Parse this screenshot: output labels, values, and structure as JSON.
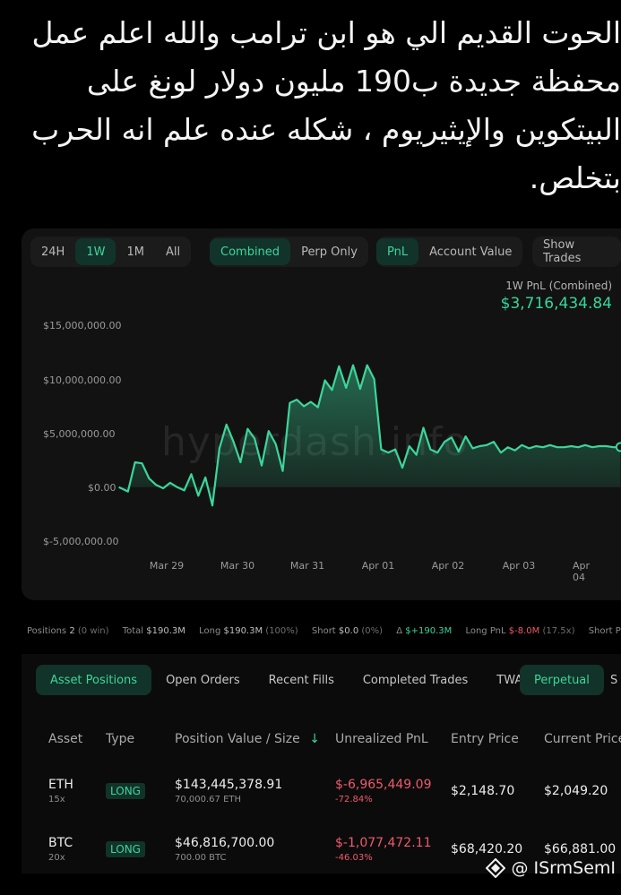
{
  "caption": "الحوت القديم الي هو ابن ترامب والله اعلم عمل\nمحفظة جديدة ب190 مليون دولار لونغ على\nالبيتكوين والإيثيريوم ، شكله عنده علم انه الحرب\nبتخلص.",
  "time_filters": [
    {
      "label": "24H",
      "active": false
    },
    {
      "label": "1W",
      "active": true
    },
    {
      "label": "1M",
      "active": false
    },
    {
      "label": "All",
      "active": false
    }
  ],
  "scope_filters": [
    {
      "label": "Combined",
      "active": true
    },
    {
      "label": "Perp Only",
      "active": false
    }
  ],
  "metric_filters": [
    {
      "label": "PnL",
      "active": true
    },
    {
      "label": "Account Value",
      "active": false
    }
  ],
  "show_trades_label": "Show Trades",
  "pnl_title": "1W PnL (Combined)",
  "pnl_value": "$3,716,434.84",
  "watermark": "hyperdash.info",
  "chart_data": {
    "type": "area",
    "y_ticks": [
      "$15,000,000.00",
      "$10,000,000.00",
      "$5,000,000.00",
      "$0.00",
      "$-5,000,000.00"
    ],
    "x_ticks": [
      "Mar 29",
      "Mar 30",
      "Mar 31",
      "Apr 01",
      "Apr 02",
      "Apr 03",
      "Apr 04"
    ],
    "ylim": [
      -5000000,
      15000000
    ],
    "xlim": [
      0,
      7.0
    ],
    "line_color": "#3dd59b",
    "x": [
      -0.68,
      -0.55,
      -0.45,
      -0.35,
      -0.25,
      -0.15,
      -0.05,
      0.05,
      0.15,
      0.25,
      0.35,
      0.45,
      0.55,
      0.65,
      0.75,
      0.85,
      0.95,
      1.05,
      1.15,
      1.25,
      1.35,
      1.45,
      1.55,
      1.65,
      1.75,
      1.85,
      1.95,
      2.05,
      2.15,
      2.25,
      2.35,
      2.45,
      2.55,
      2.65,
      2.75,
      2.85,
      2.95,
      3.05,
      3.15,
      3.25,
      3.35,
      3.45,
      3.55,
      3.65,
      3.75,
      3.85,
      3.95,
      4.05,
      4.15,
      4.25,
      4.35,
      4.45,
      4.55,
      4.65,
      4.75,
      4.85,
      4.95,
      5.05,
      5.15,
      5.25,
      5.35,
      5.45,
      5.55,
      5.65,
      5.75,
      5.85,
      5.95,
      6.05,
      6.15,
      6.25,
      6.35,
      6.45
    ],
    "y": [
      0,
      -400000,
      2300000,
      2200000,
      800000,
      200000,
      -100000,
      400000,
      0,
      -300000,
      1200000,
      -800000,
      900000,
      -1700000,
      3600000,
      5800000,
      4200000,
      2300000,
      5400000,
      4500000,
      2000000,
      5200000,
      4000000,
      1500000,
      7800000,
      8100000,
      7500000,
      7900000,
      7400000,
      9900000,
      9000000,
      11200000,
      9200000,
      11300000,
      9100000,
      11300000,
      10000000,
      3500000,
      3200000,
      3500000,
      1800000,
      3800000,
      3000000,
      5500000,
      3500000,
      3200000,
      4200000,
      4600000,
      3300000,
      4700000,
      3600000,
      3800000,
      3900000,
      4200000,
      3200000,
      3700000,
      3400000,
      3900000,
      3600000,
      3800000,
      3700000,
      3900000,
      3700000,
      3700000,
      3800000,
      3700000,
      3900000,
      3700000,
      3800000,
      3800000,
      3700000,
      3716435
    ],
    "title": "1W PnL (Combined)",
    "grid": false
  },
  "summary": {
    "positions_label": "Positions",
    "positions_value": "2",
    "positions_win": "(0 win)",
    "total_label": "Total",
    "total_value": "$190.3M",
    "long_label": "Long",
    "long_value": "$190.3M",
    "long_pct": "(100%)",
    "short_label": "Short",
    "short_value": "$0.0",
    "short_pct": "(0%)",
    "delta_label": "Δ",
    "delta_value": "$+190.3M",
    "long_pnl_label": "Long PnL",
    "long_pnl_value": "$-8.0M",
    "long_pnl_ratio": "(17.5x)",
    "short_pnl_label": "Short PnL"
  },
  "tabs": [
    {
      "label": "Asset Positions",
      "active": true
    },
    {
      "label": "Open Orders",
      "active": false
    },
    {
      "label": "Recent Fills",
      "active": false
    },
    {
      "label": "Completed Trades",
      "active": false
    },
    {
      "label": "TWAP",
      "active": false
    }
  ],
  "perpetual_label": "Perpetual",
  "next_tab_peek": "S",
  "columns": {
    "asset": "Asset",
    "type": "Type",
    "position_value": "Position Value / Size",
    "sort_icon": "↓",
    "unrealized_pnl": "Unrealized PnL",
    "entry_price": "Entry Price",
    "current_price": "Current Price"
  },
  "rows": [
    {
      "asset": "ETH",
      "leverage": "15x",
      "type": "LONG",
      "position_value": "$143,445,378.91",
      "size": "70,000.67 ETH",
      "pnl": "$-6,965,449.09",
      "pnl_pct": "-72.84%",
      "entry_price": "$2,148.70",
      "current_price": "$2,049.20"
    },
    {
      "asset": "BTC",
      "leverage": "20x",
      "type": "LONG",
      "position_value": "$46,816,700.00",
      "size": "700.00 BTC",
      "pnl": "$-1,077,472.11",
      "pnl_pct": "-46.03%",
      "entry_price": "$68,420.20",
      "current_price": "$66,881.00"
    }
  ],
  "credit": "@ ISrmSemI",
  "credit_icon": "weibo-style-diamond-logo"
}
